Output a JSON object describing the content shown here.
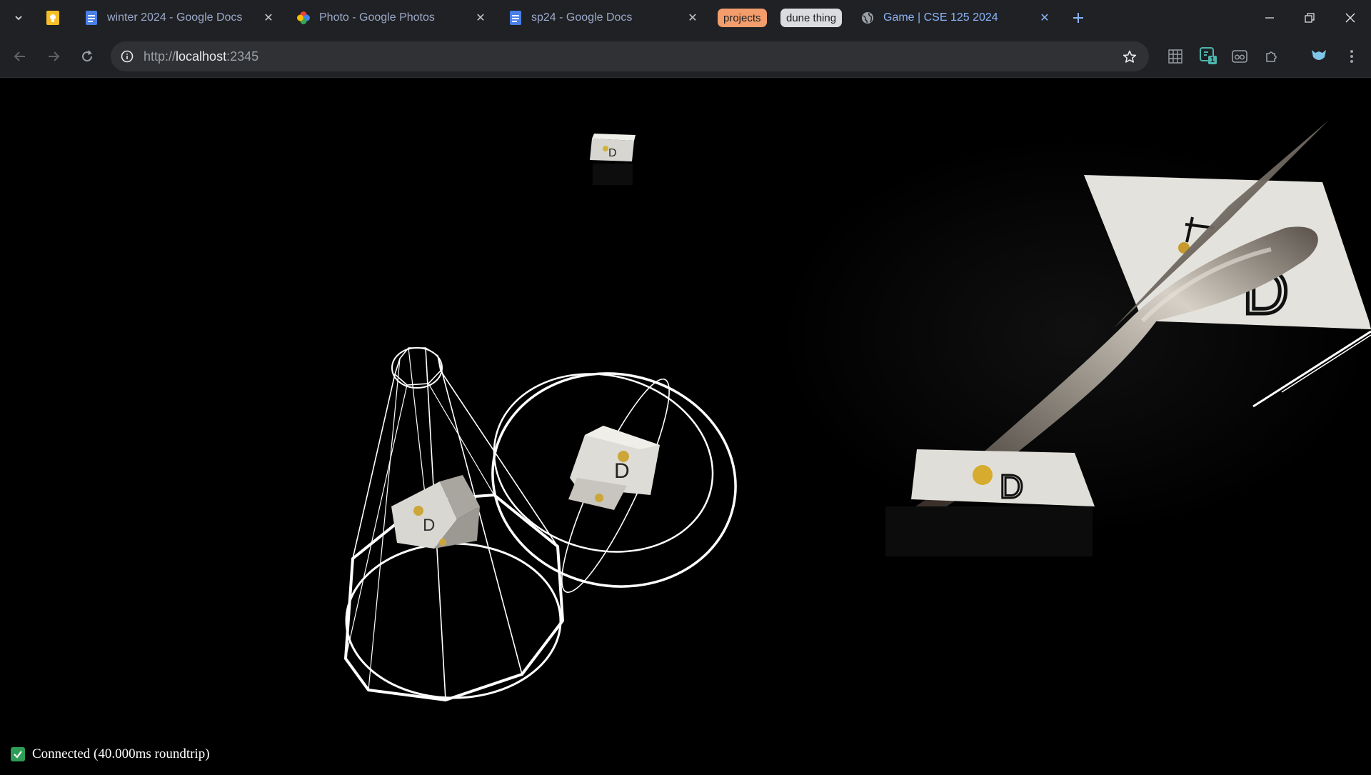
{
  "tabs": [
    {
      "title": "winter 2024 - Google Docs",
      "icon": "google-docs-icon"
    },
    {
      "title": "Photo - Google Photos",
      "icon": "google-photos-icon"
    },
    {
      "title": "sp24 - Google Docs",
      "icon": "google-docs-icon"
    },
    {
      "title": "Game | CSE 125 2024",
      "icon": "globe-icon"
    }
  ],
  "tab_groups": [
    {
      "label": "projects",
      "color": "#f29d6b"
    },
    {
      "label": "dune thing",
      "color": "#dadce0"
    }
  ],
  "address_bar": {
    "scheme": "http://",
    "host": "localhost",
    "port": ":2345"
  },
  "extension_badge": "1",
  "scene": {
    "texture_text": "D",
    "background": "#000000"
  },
  "status": {
    "text": "Connected (40.000ms roundtrip)",
    "icon": "checkbox-checked-icon",
    "color": "#2e9d57"
  }
}
